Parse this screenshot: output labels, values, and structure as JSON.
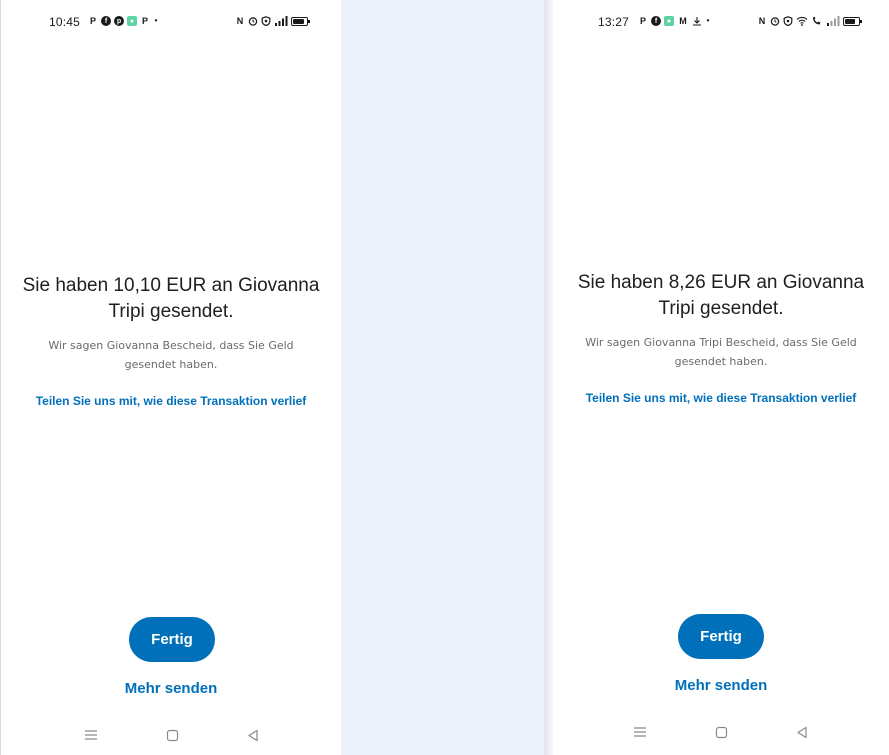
{
  "left": {
    "status_bar": {
      "time": "10:45",
      "left_icons": [
        "paypal-icon",
        "facebook-icon",
        "pinterest-icon",
        "app-icon",
        "paypal-icon",
        "dot"
      ],
      "right_icons": [
        "nfc-icon",
        "alarm-icon",
        "vpn-shield-icon",
        "signal-icon",
        "battery-icon"
      ]
    },
    "headline": "Sie haben 10,10 EUR an Giovanna Tripi gesendet.",
    "subtext": "Wir sagen Giovanna Bescheid, dass Sie Geld gesendet haben.",
    "feedback_link": "Teilen Sie uns mit, wie diese Transaktion verlief",
    "done_button": "Fertig",
    "send_more": "Mehr senden"
  },
  "right": {
    "status_bar": {
      "time": "13:27",
      "left_icons": [
        "paypal-icon",
        "facebook-icon",
        "app-icon",
        "gmail-icon",
        "download-icon",
        "dot"
      ],
      "right_icons": [
        "nfc-icon",
        "alarm-icon",
        "vpn-shield-icon",
        "wifi-icon",
        "call-icon",
        "signal-icon",
        "battery-icon"
      ]
    },
    "headline": "Sie haben 8,26 EUR an Giovanna Tripi gesendet.",
    "subtext": "Wir sagen Giovanna Tripi Bescheid, dass Sie Geld gesendet haben.",
    "feedback_link": "Teilen Sie uns mit, wie diese Transaktion verlief",
    "done_button": "Fertig",
    "send_more": "Mehr senden"
  },
  "colors": {
    "brand_blue": "#0070ba",
    "text_dark": "#1f1f1f",
    "text_muted": "#6b6b6b",
    "background_gap": "#edf2fa"
  }
}
